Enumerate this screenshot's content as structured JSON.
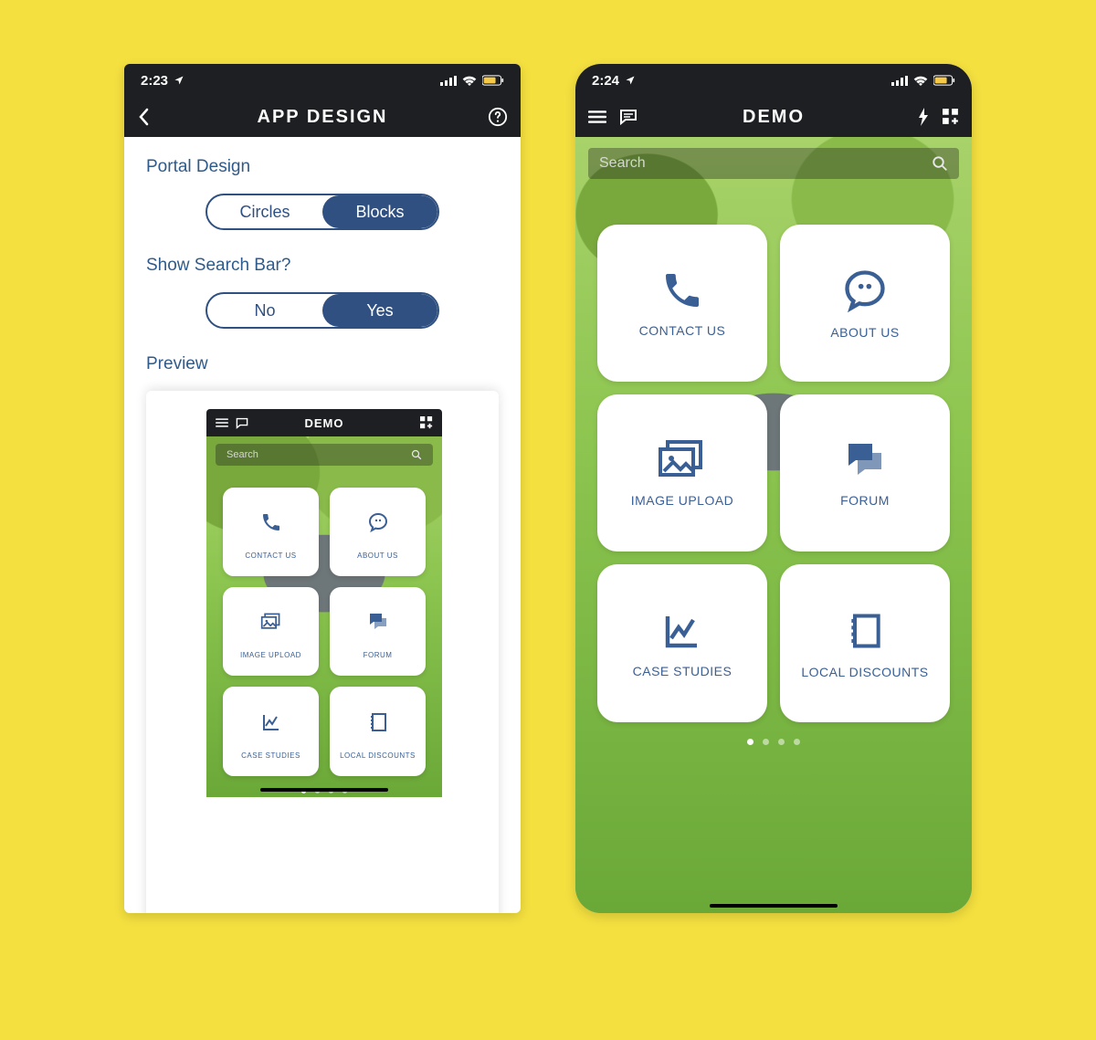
{
  "left": {
    "status": {
      "time": "2:23"
    },
    "nav": {
      "title": "APP DESIGN"
    },
    "sections": {
      "portal_label": "Portal Design",
      "portal_a": "Circles",
      "portal_b": "Blocks",
      "search_label": "Show Search Bar?",
      "search_a": "No",
      "search_b": "Yes",
      "preview_label": "Preview"
    },
    "preview": {
      "nav_title": "DEMO",
      "search_ph": "Search",
      "tiles": {
        "t0": "CONTACT US",
        "t1": "ABOUT US",
        "t2": "IMAGE UPLOAD",
        "t3": "FORUM",
        "t4": "CASE STUDIES",
        "t5": "LOCAL DISCOUNTS"
      }
    }
  },
  "right": {
    "status": {
      "time": "2:24"
    },
    "nav": {
      "title": "DEMO"
    },
    "search_ph": "Search",
    "tiles": {
      "t0": "CONTACT US",
      "t1": "ABOUT US",
      "t2": "IMAGE UPLOAD",
      "t3": "FORUM",
      "t4": "CASE STUDIES",
      "t5": "LOCAL DISCOUNTS"
    }
  }
}
